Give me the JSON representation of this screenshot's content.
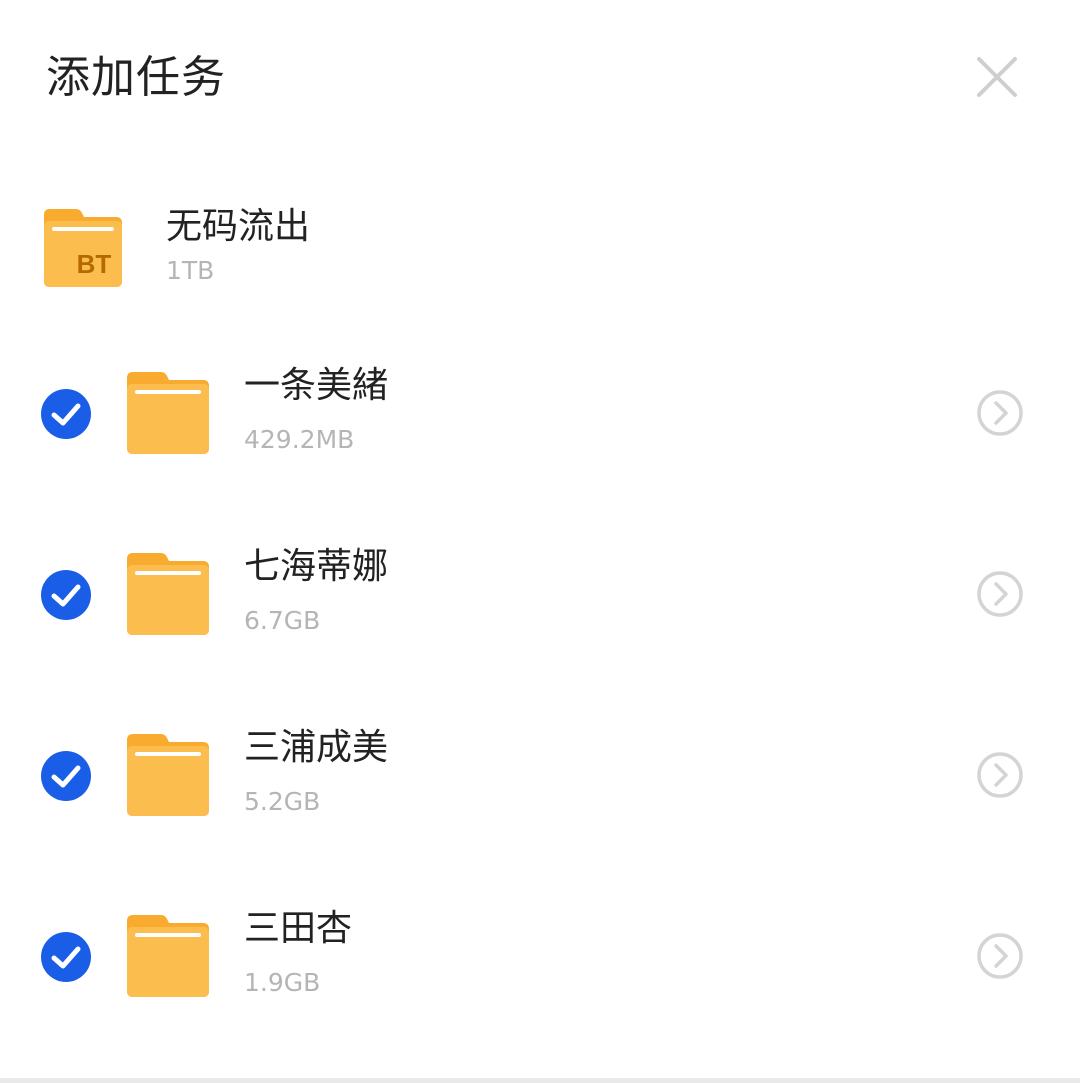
{
  "dialog": {
    "title": "添加任务",
    "close_icon": "close-icon"
  },
  "root": {
    "name": "无码流出",
    "size": "1TB",
    "badge": "BT",
    "icon": "bt-folder-icon"
  },
  "items": [
    {
      "name": "一条美緒",
      "size": "429.2MB",
      "checked": true
    },
    {
      "name": "七海蒂娜",
      "size": "6.7GB",
      "checked": true
    },
    {
      "name": "三浦成美",
      "size": "5.2GB",
      "checked": true
    },
    {
      "name": "三田杏",
      "size": "1.9GB",
      "checked": true
    }
  ],
  "colors": {
    "accent": "#1a5ee8",
    "folder": "#fbbd4e",
    "folder_tab": "#f8ab2e",
    "muted_text": "#b5b5b5",
    "chevron": "#d4d4d4"
  }
}
